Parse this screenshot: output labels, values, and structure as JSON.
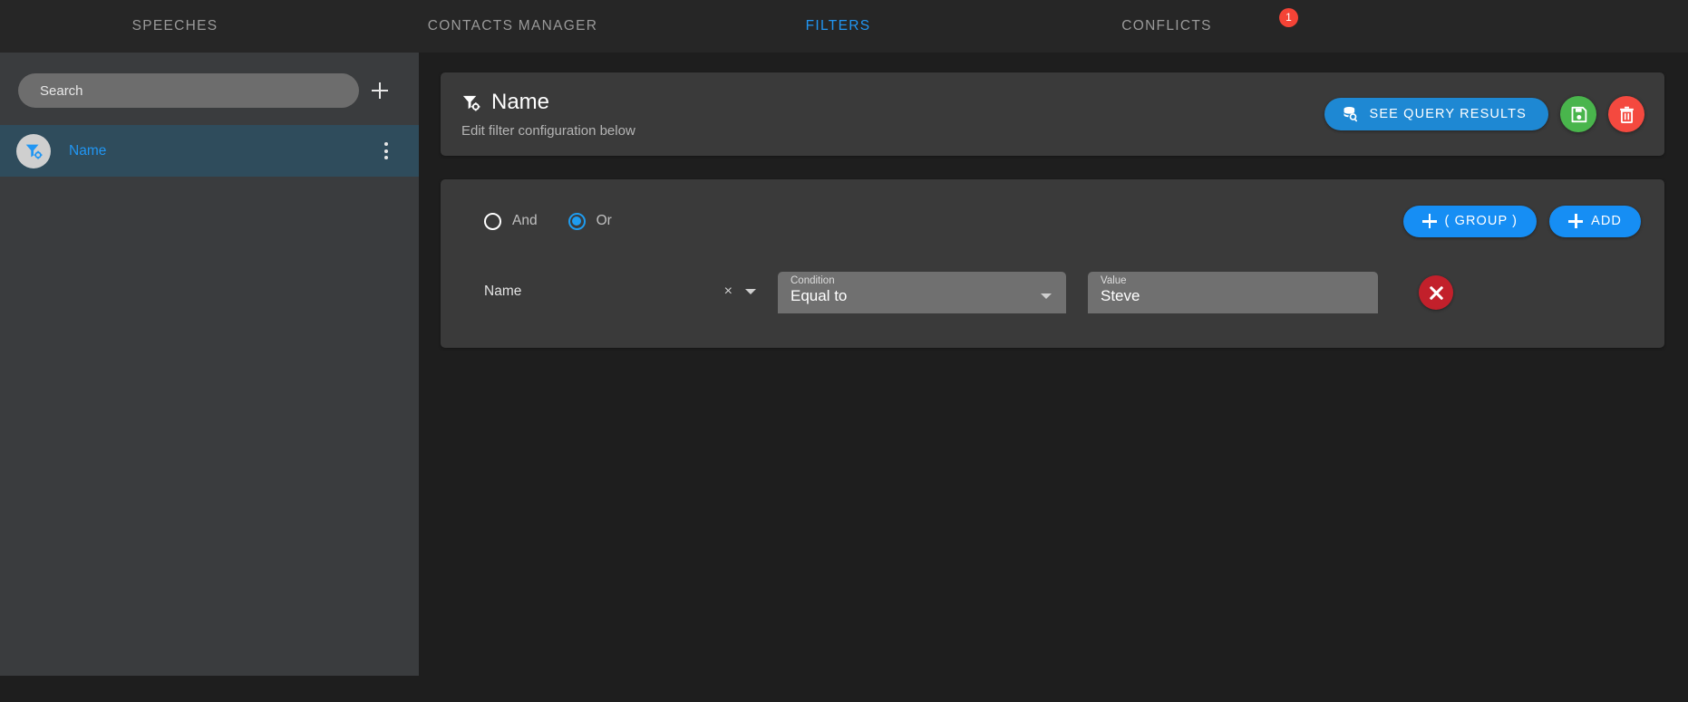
{
  "nav": {
    "tabs": [
      {
        "label": "SPEECHES",
        "active": false
      },
      {
        "label": "CONTACTS MANAGER",
        "active": false
      },
      {
        "label": "FILTERS",
        "active": true
      },
      {
        "label": "CONFLICTS",
        "active": false,
        "badge": "1"
      }
    ],
    "active_color": "#2196f3",
    "badge_color": "#f44336"
  },
  "sidebar": {
    "search": {
      "placeholder": "Search",
      "value": ""
    },
    "add_button_icon": "plus-icon",
    "items": [
      {
        "label": "Name",
        "icon": "filter-settings-icon",
        "selected": true,
        "menu_icon": "kebab-menu-icon"
      }
    ],
    "selected_bg": "#2f4c5c"
  },
  "header": {
    "icon": "filter-settings-icon",
    "title": "Name",
    "subtitle": "Edit filter configuration below",
    "query_button": {
      "label": "SEE QUERY RESULTS",
      "icon": "database-search-icon",
      "color": "#1e88d3"
    },
    "save_button": {
      "icon": "save-floppy-icon",
      "color": "#49b54c"
    },
    "delete_button": {
      "icon": "trash-icon",
      "color": "#f4493f"
    }
  },
  "rules": {
    "operators": [
      {
        "label": "And",
        "selected": false
      },
      {
        "label": "Or",
        "selected": true
      }
    ],
    "group_button": {
      "label": "( GROUP )",
      "icon": "plus-icon"
    },
    "add_button": {
      "label": "ADD",
      "icon": "plus-icon"
    },
    "button_color": "#168ef4",
    "conditions": [
      {
        "field": {
          "value": "Name",
          "clear_icon": "clear-x-icon",
          "caret_icon": "chevron-down-icon"
        },
        "condition": {
          "label": "Condition",
          "value": "Equal to",
          "caret_icon": "chevron-down-icon"
        },
        "value": {
          "label": "Value",
          "value": "Steve",
          "placeholder": ""
        },
        "remove_button": {
          "icon": "close-x-icon",
          "color": "#c2202b"
        }
      }
    ]
  }
}
